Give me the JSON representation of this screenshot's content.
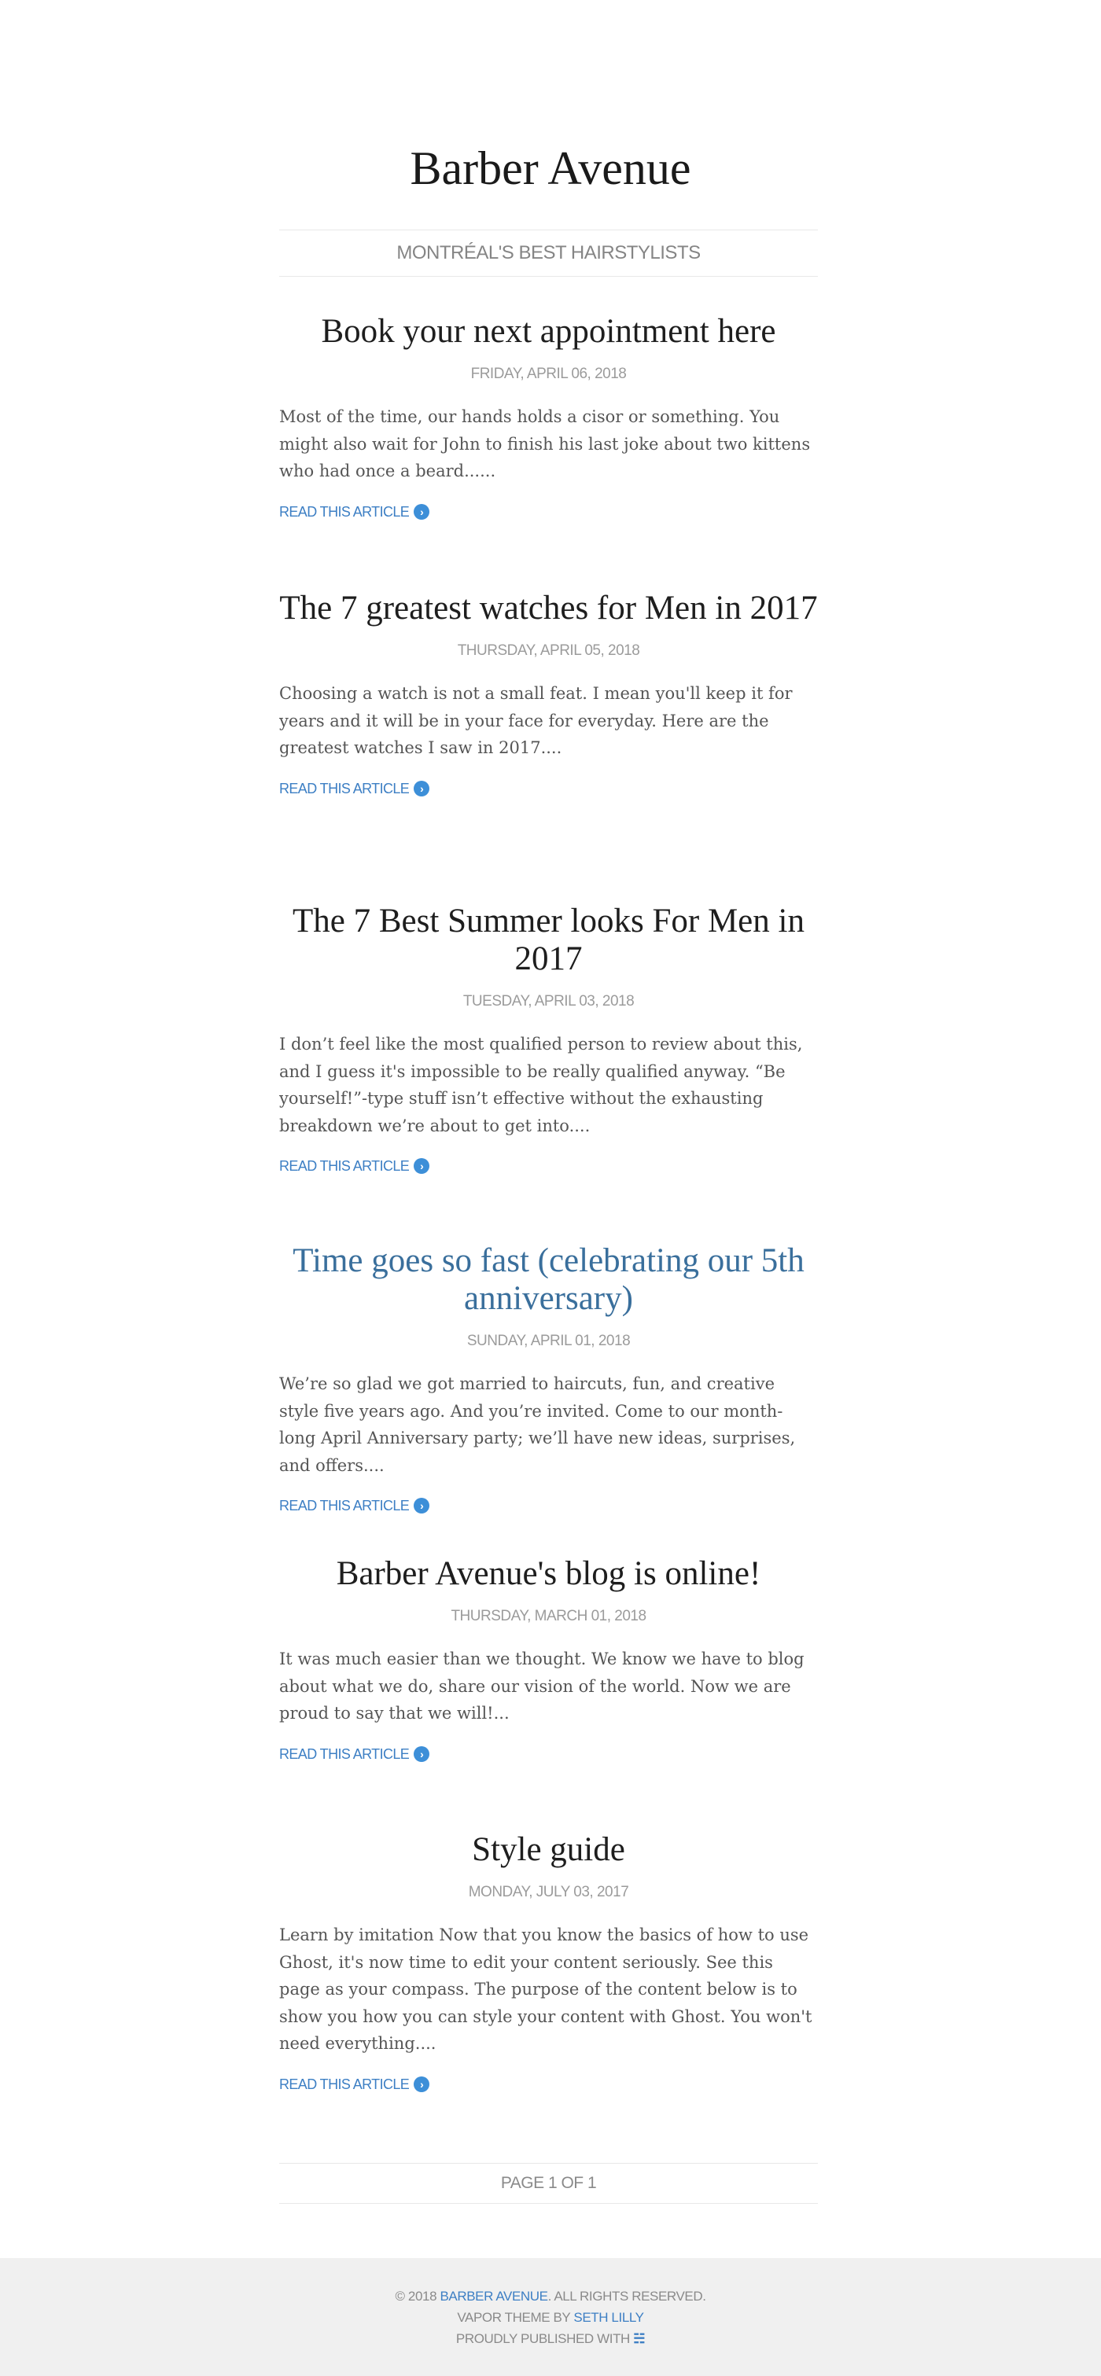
{
  "site": {
    "title": "Barber Avenue",
    "tagline": "MONTRÉAL'S BEST HAIRSTYLISTS"
  },
  "posts": [
    {
      "title": "Book your next appointment here",
      "date": "FRIDAY, APRIL 06, 2018",
      "excerpt": "Most of the time, our hands holds a cisor or something. You might also wait for John to finish his last joke about two kittens who had once a beard......",
      "read_more": "READ THIS ARTICLE"
    },
    {
      "title": "The 7 greatest watches for Men in 2017",
      "date": "THURSDAY, APRIL 05, 2018",
      "excerpt": "Choosing a watch is not a small feat. I mean you'll keep it for years and it will be in your face for everyday. Here are the greatest watches I saw in 2017....",
      "read_more": "READ THIS ARTICLE"
    },
    {
      "title": "The 7 Best Summer looks For Men in 2017",
      "date": "TUESDAY, APRIL 03, 2018",
      "excerpt": "I don’t feel like the most qualified person to review about this, and I guess it's impossible to be really qualified anyway. “Be yourself!”-type stuff isn’t effective without the exhausting breakdown we’re about to get into....",
      "read_more": "READ THIS ARTICLE"
    },
    {
      "title": "Time goes so fast (celebrating our 5th anniversary)",
      "date": "SUNDAY, APRIL 01, 2018",
      "excerpt": "We’re so glad we got married to haircuts, fun, and creative style five years ago. And you’re invited. Come to our month-long April Anniversary party; we’ll have new ideas, surprises, and offers....",
      "read_more": "READ THIS ARTICLE"
    },
    {
      "title": "Barber Avenue's blog is online!",
      "date": "THURSDAY, MARCH 01, 2018",
      "excerpt": "It was much easier than we thought. We know we have to blog about what we do, share our vision of the world. Now we are proud to say that we will!...",
      "read_more": "READ THIS ARTICLE"
    },
    {
      "title": "Style guide",
      "date": "MONDAY, JULY 03, 2017",
      "excerpt": "Learn by imitation Now that you know the basics of how to use Ghost, it's now time to edit your content seriously. See this page as your compass. The purpose of the content below is to show you how you can style your content with Ghost. You won't need everything....",
      "read_more": "READ THIS ARTICLE"
    }
  ],
  "pagination": {
    "label": "PAGE 1 OF 1"
  },
  "footer": {
    "copyright_prefix": "© 2018 ",
    "brand_link": "BARBER AVENUE",
    "copyright_suffix": ". ALL RIGHTS RESERVED.",
    "theme_prefix": "VAPOR THEME BY ",
    "theme_author_link": "SETH LILLY",
    "published_prefix": "PROUDLY PUBLISHED WITH ",
    "ghost_icon": "ghost-icon"
  },
  "colors": {
    "link": "#3d7fc4",
    "highlight_title": "#3a6f9c",
    "footer_bg": "#f0f0f0",
    "muted_text": "#8a8a8a"
  }
}
